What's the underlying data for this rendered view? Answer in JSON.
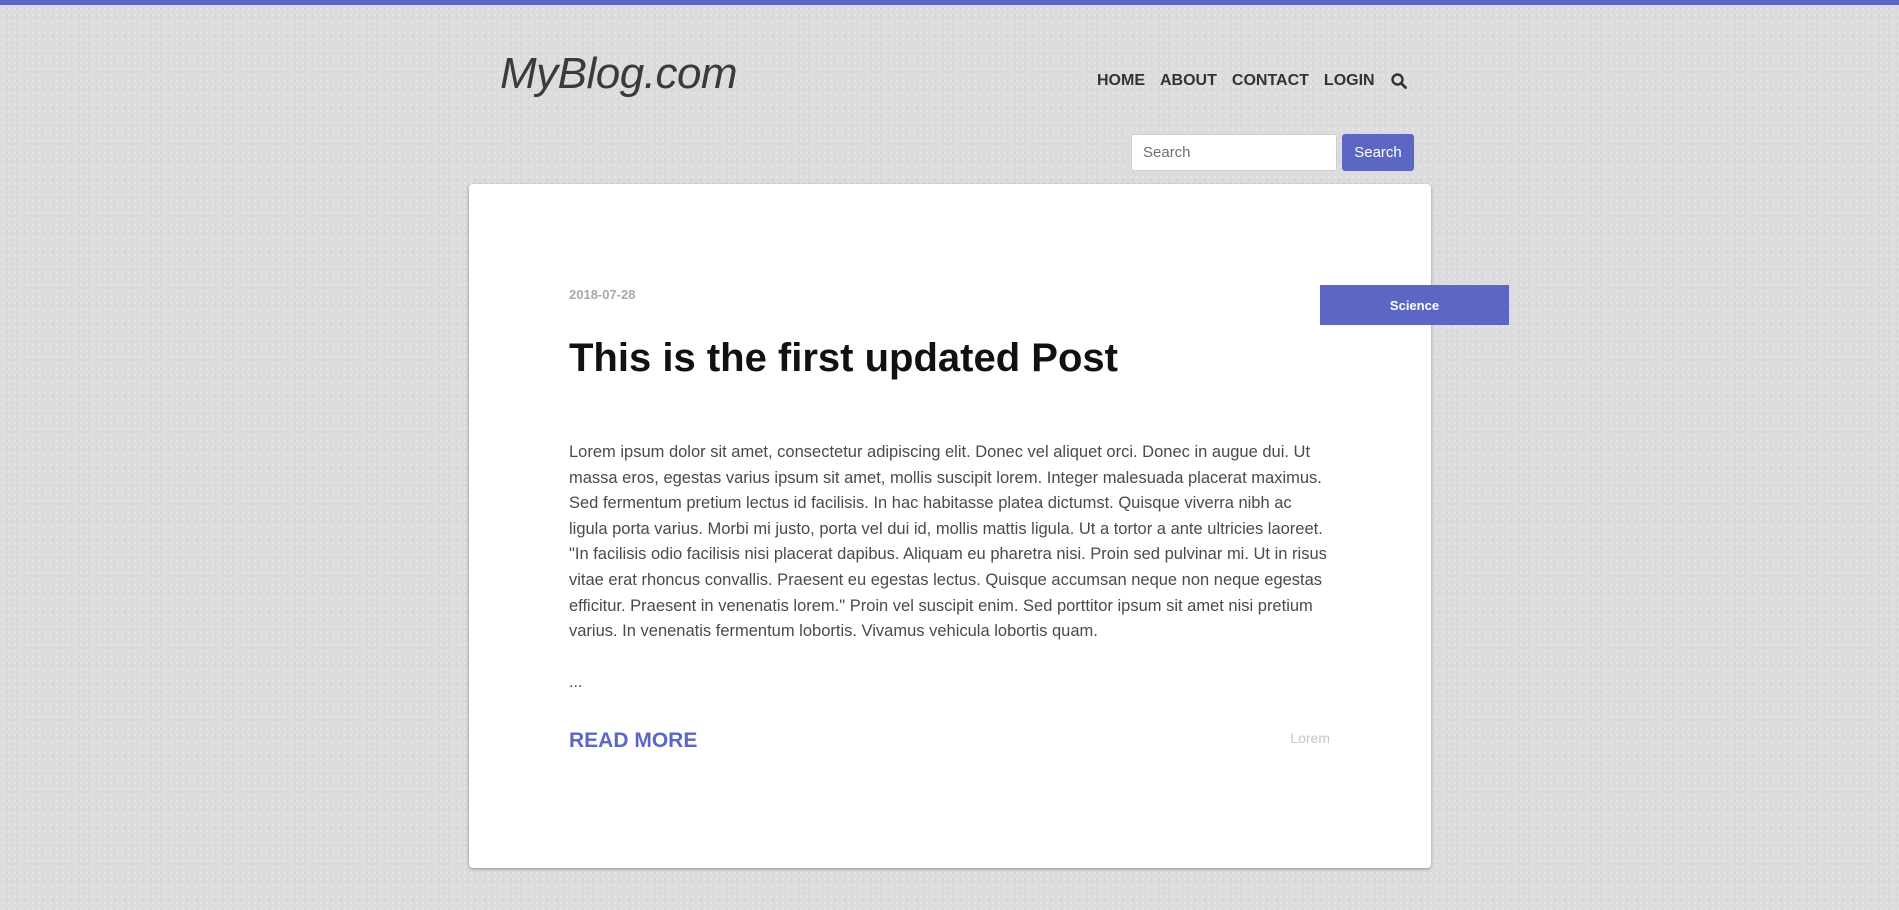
{
  "colors": {
    "accent": "#5c67c4",
    "background": "#dcdcdc",
    "card": "#ffffff"
  },
  "header": {
    "logo": "MyBlog.com",
    "nav": [
      {
        "label": "HOME"
      },
      {
        "label": "ABOUT"
      },
      {
        "label": "CONTACT"
      },
      {
        "label": "LOGIN"
      }
    ],
    "nav_icon": "search-icon"
  },
  "search": {
    "placeholder": "Search",
    "value": "",
    "button_label": "Search"
  },
  "post": {
    "date": "2018-07-28",
    "category": "Science",
    "title": "This is the first updated Post",
    "body": "Lorem ipsum dolor sit amet, consectetur adipiscing elit. Donec vel aliquet orci. Donec in augue dui. Ut massa eros, egestas varius ipsum sit amet, mollis suscipit lorem. Integer malesuada placerat maximus. Sed fermentum pretium lectus id facilisis. In hac habitasse platea dictumst. Quisque viverra nibh ac ligula porta varius. Morbi mi justo, porta vel dui id, mollis mattis ligula. Ut a tortor a ante ultricies laoreet. \"In facilisis odio facilisis nisi placerat dapibus. Aliquam eu pharetra nisi. Proin sed pulvinar mi. Ut in risus vitae erat rhoncus convallis. Praesent eu egestas lectus. Quisque accumsan neque non neque egestas efficitur. Praesent in venenatis lorem.\" Proin vel suscipit enim. Sed porttitor ipsum sit amet nisi pretium varius. In venenatis fermentum lobortis. Vivamus vehicula lobortis quam.",
    "ellipsis": "...",
    "read_more_label": "READ MORE",
    "tag": "Lorem"
  }
}
